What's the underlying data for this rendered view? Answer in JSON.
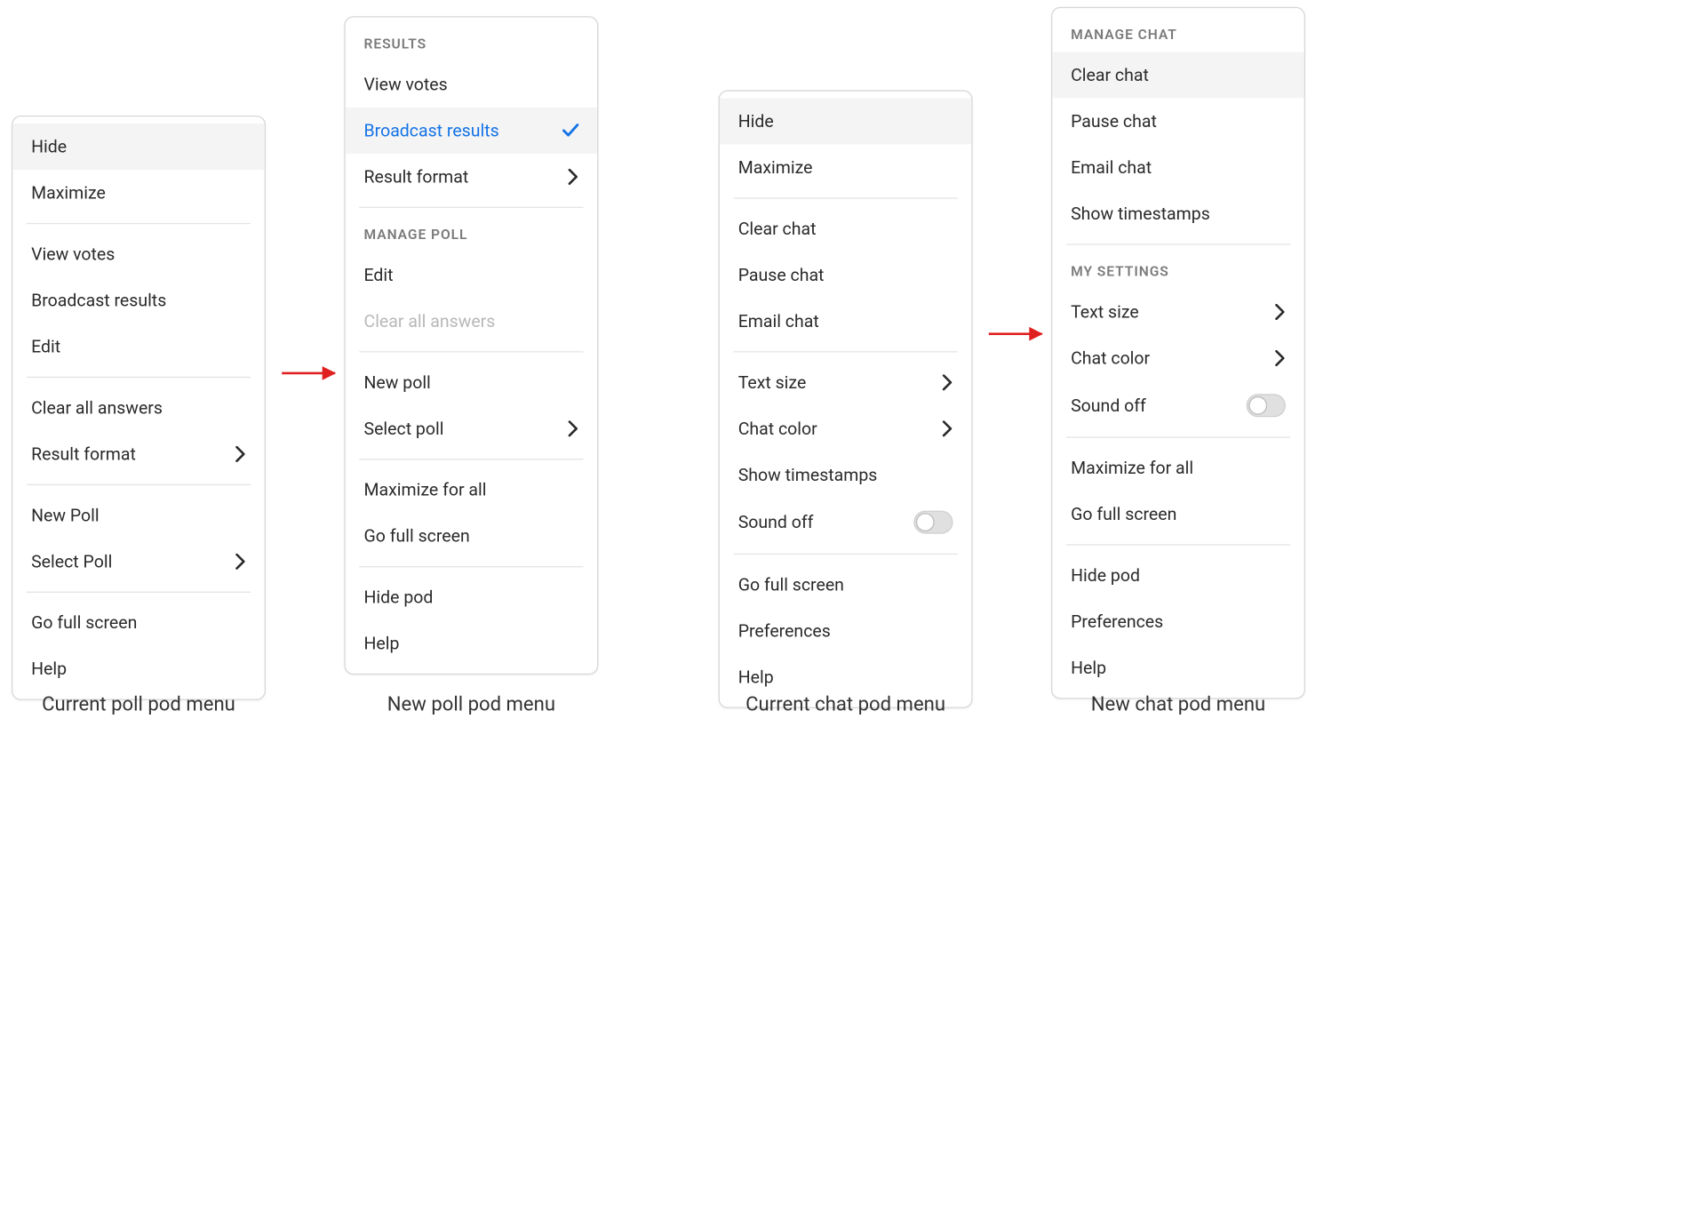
{
  "captions": {
    "current_poll": "Current poll pod menu",
    "new_poll": "New poll pod menu",
    "current_chat": "Current chat pod menu",
    "new_chat": "New chat pod menu"
  },
  "panels": {
    "currentPoll": {
      "groups": [
        {
          "items": [
            {
              "key": "hide",
              "label": "Hide",
              "hovered": true
            },
            {
              "key": "maximize",
              "label": "Maximize"
            }
          ]
        },
        {
          "items": [
            {
              "key": "view-votes",
              "label": "View votes"
            },
            {
              "key": "broadcast-results",
              "label": "Broadcast results"
            },
            {
              "key": "edit",
              "label": "Edit"
            }
          ]
        },
        {
          "items": [
            {
              "key": "clear-all-answers",
              "label": "Clear all answers"
            },
            {
              "key": "result-format",
              "label": "Result format",
              "trail": "chevron"
            }
          ]
        },
        {
          "items": [
            {
              "key": "new-poll",
              "label": "New Poll"
            },
            {
              "key": "select-poll",
              "label": "Select Poll",
              "trail": "chevron"
            }
          ]
        },
        {
          "items": [
            {
              "key": "go-full-screen",
              "label": "Go full screen"
            },
            {
              "key": "help",
              "label": "Help"
            }
          ]
        }
      ]
    },
    "newPoll": {
      "groups": [
        {
          "header": "RESULTS",
          "items": [
            {
              "key": "view-votes",
              "label": "View votes"
            },
            {
              "key": "broadcast-results",
              "label": "Broadcast results",
              "selected": true,
              "trail": "check"
            },
            {
              "key": "result-format",
              "label": "Result format",
              "trail": "chevron"
            }
          ]
        },
        {
          "header": "MANAGE POLL",
          "items": [
            {
              "key": "edit",
              "label": "Edit"
            },
            {
              "key": "clear-all-answers",
              "label": "Clear all answers",
              "disabled": true
            }
          ]
        },
        {
          "items": [
            {
              "key": "new-poll",
              "label": "New poll"
            },
            {
              "key": "select-poll",
              "label": "Select poll",
              "trail": "chevron"
            }
          ]
        },
        {
          "items": [
            {
              "key": "maximize-for-all",
              "label": "Maximize for all"
            },
            {
              "key": "go-full-screen",
              "label": "Go full screen"
            }
          ]
        },
        {
          "items": [
            {
              "key": "hide-pod",
              "label": "Hide pod"
            },
            {
              "key": "help",
              "label": "Help"
            }
          ]
        }
      ]
    },
    "currentChat": {
      "groups": [
        {
          "items": [
            {
              "key": "hide",
              "label": "Hide",
              "hovered": true
            },
            {
              "key": "maximize",
              "label": "Maximize"
            }
          ]
        },
        {
          "items": [
            {
              "key": "clear-chat",
              "label": "Clear chat"
            },
            {
              "key": "pause-chat",
              "label": "Pause chat"
            },
            {
              "key": "email-chat",
              "label": "Email chat"
            }
          ]
        },
        {
          "items": [
            {
              "key": "text-size",
              "label": "Text size",
              "trail": "chevron"
            },
            {
              "key": "chat-color",
              "label": "Chat color",
              "trail": "chevron"
            },
            {
              "key": "show-timestamps",
              "label": "Show timestamps"
            },
            {
              "key": "sound-off",
              "label": "Sound off",
              "trail": "toggle"
            }
          ]
        },
        {
          "items": [
            {
              "key": "go-full-screen",
              "label": "Go full screen"
            },
            {
              "key": "preferences",
              "label": "Preferences"
            },
            {
              "key": "help",
              "label": "Help"
            }
          ]
        }
      ]
    },
    "newChat": {
      "groups": [
        {
          "header": "MANAGE CHAT",
          "items": [
            {
              "key": "clear-chat",
              "label": "Clear chat",
              "hovered": true
            },
            {
              "key": "pause-chat",
              "label": "Pause chat"
            },
            {
              "key": "email-chat",
              "label": "Email chat"
            },
            {
              "key": "show-timestamps",
              "label": "Show timestamps"
            }
          ]
        },
        {
          "header": "MY SETTINGS",
          "items": [
            {
              "key": "text-size",
              "label": "Text size",
              "trail": "chevron"
            },
            {
              "key": "chat-color",
              "label": "Chat color",
              "trail": "chevron"
            },
            {
              "key": "sound-off",
              "label": "Sound off",
              "trail": "toggle"
            }
          ]
        },
        {
          "items": [
            {
              "key": "maximize-for-all",
              "label": "Maximize for all"
            },
            {
              "key": "go-full-screen",
              "label": "Go full screen"
            }
          ]
        },
        {
          "items": [
            {
              "key": "hide-pod",
              "label": "Hide pod"
            },
            {
              "key": "preferences",
              "label": "Preferences"
            },
            {
              "key": "help",
              "label": "Help"
            }
          ]
        }
      ]
    }
  }
}
